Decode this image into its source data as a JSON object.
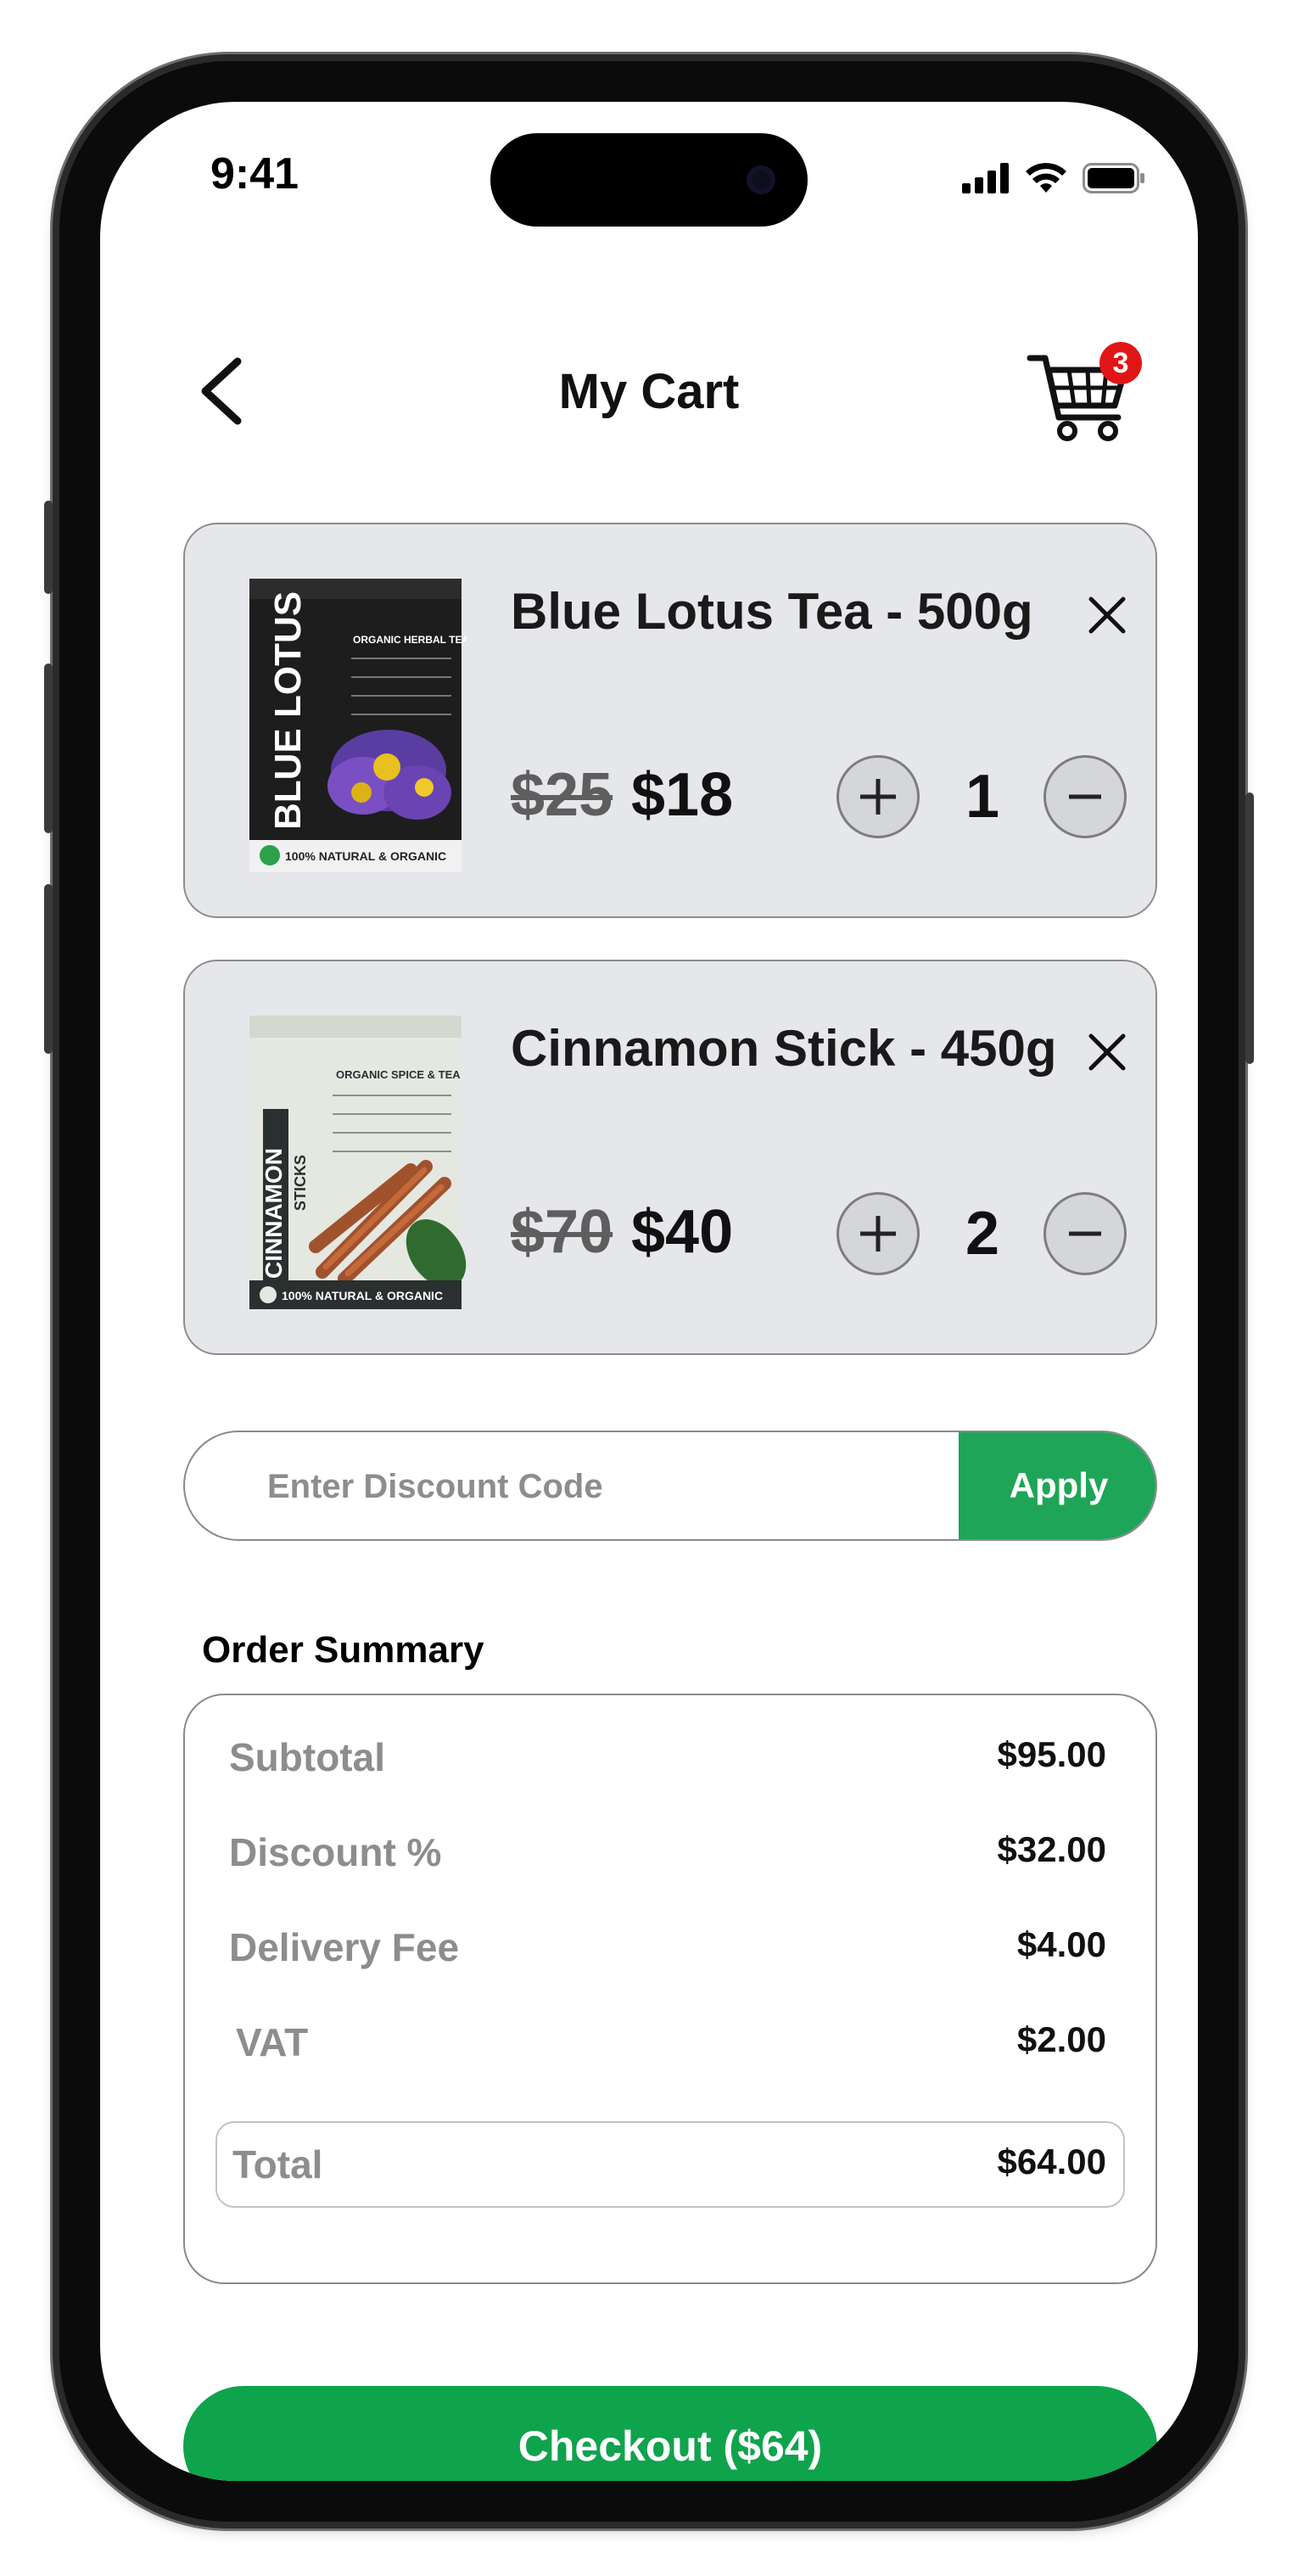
{
  "status_bar": {
    "time": "9:41"
  },
  "header": {
    "title": "My Cart",
    "cart_badge": "3"
  },
  "cart_items": [
    {
      "name": "Blue Lotus Tea - 500g",
      "old_price": "$25",
      "price": "$18",
      "quantity": "1",
      "package": {
        "brand": "BLUE LOTUS",
        "headline": "ORGANIC HERBAL TEA",
        "footer": "100% NATURAL & ORGANIC",
        "color": "#1c1c1c"
      }
    },
    {
      "name": "Cinnamon Stick - 450g",
      "old_price": "$70",
      "price": "$40",
      "quantity": "2",
      "package": {
        "brand": "CINNAMON",
        "brand_sub": "STICKS",
        "headline": "ORGANIC SPICE & TEA",
        "footer": "100% NATURAL & ORGANIC",
        "color": "#e4e8e0"
      }
    }
  ],
  "discount": {
    "placeholder": "Enter Discount Code",
    "apply_label": "Apply"
  },
  "order_summary": {
    "heading": "Order Summary",
    "rows": [
      {
        "label": "Subtotal",
        "value": "$95.00"
      },
      {
        "label": "Discount %",
        "value": "$32.00"
      },
      {
        "label": "Delivery Fee",
        "value": "$4.00"
      },
      {
        "label": "VAT",
        "value": "$2.00"
      }
    ],
    "total": {
      "label": "Total",
      "value": "$64.00"
    }
  },
  "checkout": {
    "label": "Checkout ($64)"
  },
  "colors": {
    "accent": "#0fa34c",
    "badge": "#e01616",
    "card": "#e6e7eb"
  }
}
